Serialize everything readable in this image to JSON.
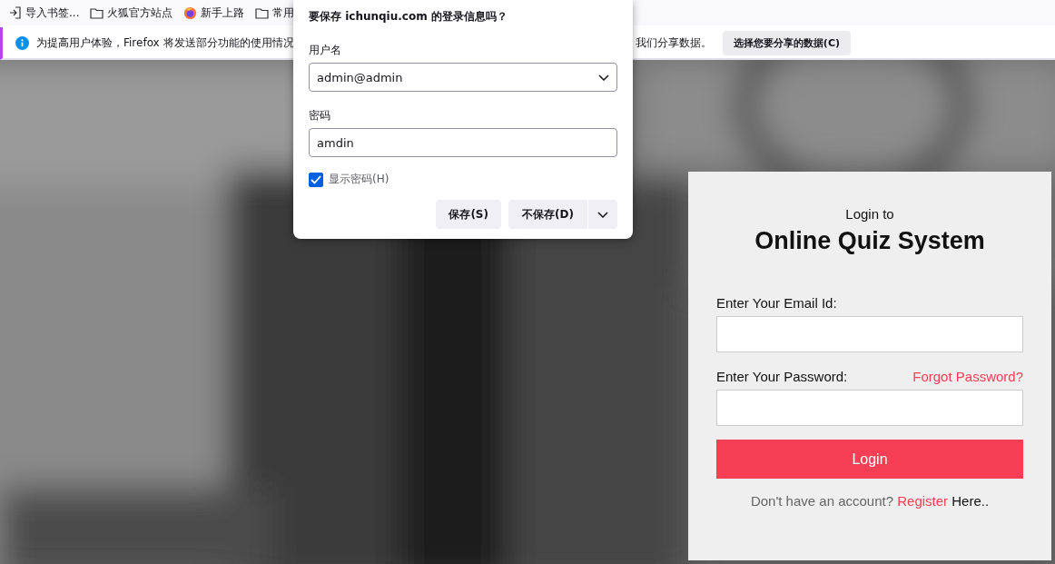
{
  "bookmarks": [
    {
      "kind": "import",
      "label": "导入书签..."
    },
    {
      "kind": "folder",
      "label": "火狐官方站点"
    },
    {
      "kind": "firefox",
      "label": "新手上路"
    },
    {
      "kind": "folder",
      "label": "常用"
    }
  ],
  "notification": {
    "text_start": "为提高用户体验，Firefox 将发送部分功能的使用情况",
    "text_end": "我们分享数据。",
    "button": "选择您要分享的数据(C)"
  },
  "save_dialog": {
    "title": "要保存 ichunqiu.com 的登录信息吗？",
    "username_label": "用户名",
    "username_value": "admin@admin",
    "password_label": "密码",
    "password_value": "amdin",
    "show_password": {
      "label": "显示密码(H)",
      "checked": true
    },
    "buttons": [
      "保存(S)",
      "不保存(D)"
    ]
  },
  "login_card": {
    "subtitle": "Login to",
    "title": "Online Quiz System",
    "email_label": "Enter Your Email Id:",
    "password_label": "Enter Your Password:",
    "forgot_link": "Forgot Password?",
    "login_button": "Login",
    "footer": {
      "prefix": "Don't have an account?",
      "link": "Register",
      "suffix": "Here.."
    }
  }
}
